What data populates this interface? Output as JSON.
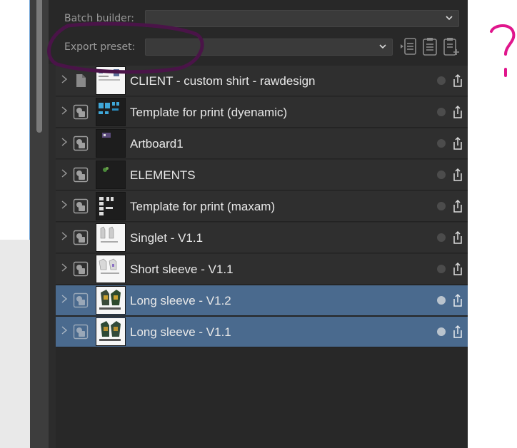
{
  "batch_builder": {
    "label": "Batch builder:",
    "value": ""
  },
  "export_preset": {
    "label": "Export preset:",
    "value": ""
  },
  "toolbar": {
    "icons": [
      "list-indent-icon",
      "clipboard-icon",
      "clipboard-add-icon"
    ]
  },
  "layers": [
    {
      "name": "CLIENT - custom shirt - rawdesign",
      "type": "document",
      "thumb": "white-sheet",
      "selected": false
    },
    {
      "name": "Template for print (dyenamic)",
      "type": "artboard",
      "thumb": "blue-parts",
      "selected": false
    },
    {
      "name": "Artboard1",
      "type": "artboard",
      "thumb": "dark-small",
      "selected": false
    },
    {
      "name": "ELEMENTS",
      "type": "artboard",
      "thumb": "dark-green",
      "selected": false
    },
    {
      "name": "Template for print (maxam)",
      "type": "artboard",
      "thumb": "dark-white-parts",
      "selected": false
    },
    {
      "name": "Singlet - V1.1",
      "type": "artboard",
      "thumb": "white-singlet",
      "selected": false
    },
    {
      "name": "Short sleeve - V1.1",
      "type": "artboard",
      "thumb": "white-short",
      "selected": false
    },
    {
      "name": "Long sleeve - V1.2",
      "type": "artboard",
      "thumb": "white-long",
      "selected": true
    },
    {
      "name": "Long sleeve - V1.1",
      "type": "artboard",
      "thumb": "white-long",
      "selected": true
    }
  ],
  "annotations": {
    "question_mark_color": "#e0168c",
    "circle_color": "#4a1448"
  },
  "colors": {
    "panel_bg": "#282828",
    "row_bg": "#2f2f2f",
    "selected_bg": "#4a6a8e"
  }
}
